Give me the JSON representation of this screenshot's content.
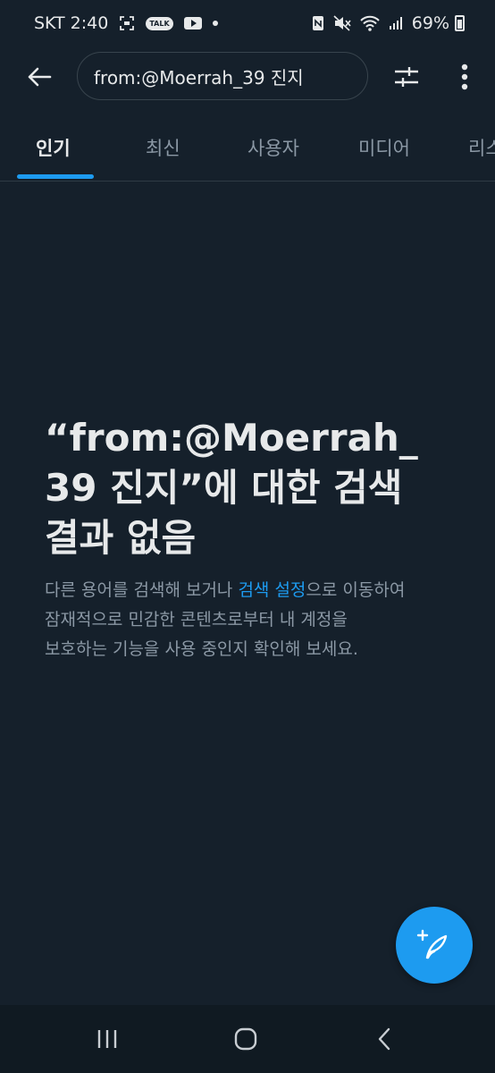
{
  "status_bar": {
    "carrier": "SKT",
    "time": "2:40",
    "talk_badge": "TALK",
    "battery": "69%",
    "icons": [
      "screenshot-icon",
      "kakaotalk-icon",
      "youtube-icon",
      "dot-icon",
      "nfc-icon",
      "mute-icon",
      "wifi-icon",
      "signal-icon",
      "battery-icon"
    ]
  },
  "top_bar": {
    "search_query": "from:@Moerrah_39 진지",
    "icons": [
      "back-arrow-icon",
      "filter-sliders-icon",
      "more-vertical-icon"
    ]
  },
  "tabs": [
    {
      "label": "인기",
      "active": true
    },
    {
      "label": "최신",
      "active": false
    },
    {
      "label": "사용자",
      "active": false
    },
    {
      "label": "미디어",
      "active": false
    },
    {
      "label": "리스",
      "active": false
    }
  ],
  "empty_state": {
    "title_line1": "“from:@Moerrah_",
    "title_line2": "39 진지”에 대한 검색",
    "title_line3": "결과 없음",
    "desc_line1_before": "다른 용어를 검색해 보거나 ",
    "desc_link": "검색 설정",
    "desc_line1_after": "으로 이동하여",
    "desc_line2": "잠재적으로 민감한 콘텐츠로부터 내 계정을",
    "desc_line3": "보호하는 기능을 사용 중인지 확인해 보세요."
  },
  "fab": {
    "icon": "compose-feather-plus-icon"
  },
  "colors": {
    "background": "#15202b",
    "accent": "#1d9bf0",
    "text_primary": "#e7e9ea",
    "text_secondary": "#8b98a5"
  },
  "nav_bar": {
    "icons": [
      "recent-apps-icon",
      "home-icon",
      "back-icon"
    ]
  }
}
